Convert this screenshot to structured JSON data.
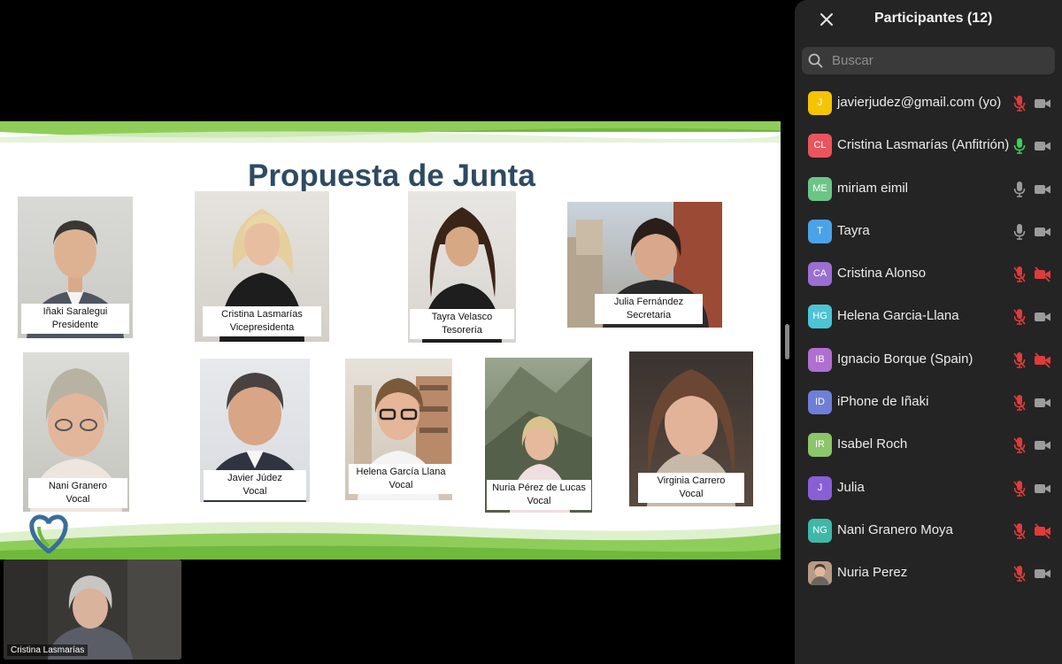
{
  "slide": {
    "title": "Propuesta de Junta",
    "members": [
      {
        "name": "Iñaki Saralegui",
        "role": "Presidente"
      },
      {
        "name": "Cristina Lasmarías",
        "role": "Vicepresidenta"
      },
      {
        "name": "Tayra Velasco",
        "role": "Tesorería"
      },
      {
        "name": "Julia Fernández",
        "role": "Secretaria"
      },
      {
        "name": "Nani Granero",
        "role": "Vocal"
      },
      {
        "name": "Javier Júdez",
        "role": "Vocal"
      },
      {
        "name": "Helena García Llana",
        "role": "Vocal"
      },
      {
        "name": "Nuria Pérez de Lucas",
        "role": "Vocal"
      },
      {
        "name": "Virginia Carrero",
        "role": "Vocal"
      }
    ]
  },
  "self_view": {
    "name": "Cristina Lasmarías"
  },
  "panel": {
    "title": "Participantes (12)",
    "search_placeholder": "Buscar",
    "participants": [
      {
        "initials": "J",
        "name": "javierjudez@gmail.com (yo)",
        "avatar_color": "#f5c400",
        "mic": "muted",
        "cam": "off"
      },
      {
        "initials": "CL",
        "name": "Cristina Lasmarías (Anfitrión)",
        "avatar_color": "#e8555d",
        "mic": "active",
        "cam": "off"
      },
      {
        "initials": "ME",
        "name": "miriam eimil",
        "avatar_color": "#6cc587",
        "mic": "on",
        "cam": "off"
      },
      {
        "initials": "T",
        "name": "Tayra",
        "avatar_color": "#4aa3e8",
        "mic": "on",
        "cam": "off"
      },
      {
        "initials": "CA",
        "name": "Cristina Alonso",
        "avatar_color": "#9b6fd1",
        "mic": "muted",
        "cam": "muted"
      },
      {
        "initials": "HG",
        "name": "Helena Garcia-Llana",
        "avatar_color": "#4cc4d6",
        "mic": "muted",
        "cam": "off"
      },
      {
        "initials": "IB",
        "name": "Ignacio Borque (Spain)",
        "avatar_color": "#b06fd1",
        "mic": "muted",
        "cam": "muted"
      },
      {
        "initials": "ID",
        "name": "iPhone de Iñaki",
        "avatar_color": "#6e7fd8",
        "mic": "muted",
        "cam": "off"
      },
      {
        "initials": "IR",
        "name": "Isabel Roch",
        "avatar_color": "#8cc56a",
        "mic": "muted",
        "cam": "off"
      },
      {
        "initials": "J",
        "name": "Julia",
        "avatar_color": "#8a5fd6",
        "mic": "muted",
        "cam": "off"
      },
      {
        "initials": "NG",
        "name": "Nani Granero Moya",
        "avatar_color": "#3fb8a8",
        "mic": "muted",
        "cam": "muted"
      },
      {
        "initials": "",
        "name": "Nuria Perez",
        "avatar_color": "#9a7a6a",
        "mic": "muted",
        "cam": "off"
      }
    ]
  },
  "colors": {
    "panel_bg": "#242424",
    "muted_red": "#e03b3b",
    "mic_green": "#3ccf5a",
    "icon_grey": "#9c9c9c",
    "slide_title": "#2e4a62",
    "slide_green": "#7cc24a"
  }
}
